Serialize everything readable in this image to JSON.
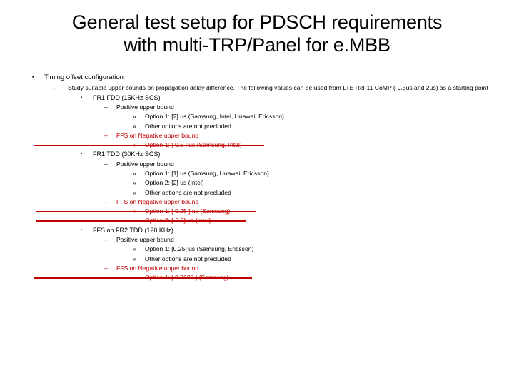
{
  "slide": {
    "title_line1": "General test setup for PDSCH requirements",
    "title_line2": "with multi-TRP/Panel for e.MBB",
    "bullets": {
      "square": "▪",
      "dash": "–",
      "guillemet": "»"
    },
    "colors": {
      "text": "#000000",
      "red": "#C00000",
      "background": "#FFFFFF"
    },
    "content": {
      "l1_timing": "Timing offset configuration",
      "l2_study": "Study suitable upper bounds on propagation delay difference. The following values can be used from LTE Rel-11 CoMP (-0.5us and 2us) as a starting point",
      "fr1_fdd_heading": "FR1  FDD (15KHz SCS)",
      "fr1_fdd_positive": "Positive upper bound",
      "fr1_fdd_pos_opt1": "Option 1: [2] us (Samsung, Intel, Huawei, Ericsson)",
      "fr1_fdd_pos_other": "Other options are not precluded",
      "fr1_fdd_ffs_negative": "FFS on Negative upper bound",
      "fr1_fdd_neg_opt1": "Option 1: [ 0.5 ] us (Samsung, Intel)",
      "fr1_tdd_heading": "FR1  TDD (30KHz SCS)",
      "fr1_tdd_positive": "Positive upper bound",
      "fr1_tdd_pos_opt1": "Option 1: [1] us (Samsung, Huawei, Ericsson)",
      "fr1_tdd_pos_opt2": "Option 2: [2] us (Intel)",
      "fr1_tdd_pos_other": "Other options are not precluded",
      "fr1_tdd_ffs_negative": "FFS on Negative upper bound",
      "fr1_tdd_neg_opt1": "Option 1: [ 0.25 ] us (Samsung)",
      "fr1_tdd_neg_opt2": "Option 2: [-0.5] us (Intel)",
      "fr2_tdd_heading": "FFS on FR2 TDD (120 KHz)",
      "fr2_tdd_positive": "Positive upper bound",
      "fr2_tdd_pos_opt1": "Option 1: [0.25] us (Samsung, Ericsson)",
      "fr2_tdd_pos_other": "Other options are not precluded",
      "fr2_tdd_ffs_negative": "FFS on Negative upper bound",
      "fr2_tdd_neg_opt1": "Option 1: [ 0.0625 ] (Samsung)"
    }
  }
}
